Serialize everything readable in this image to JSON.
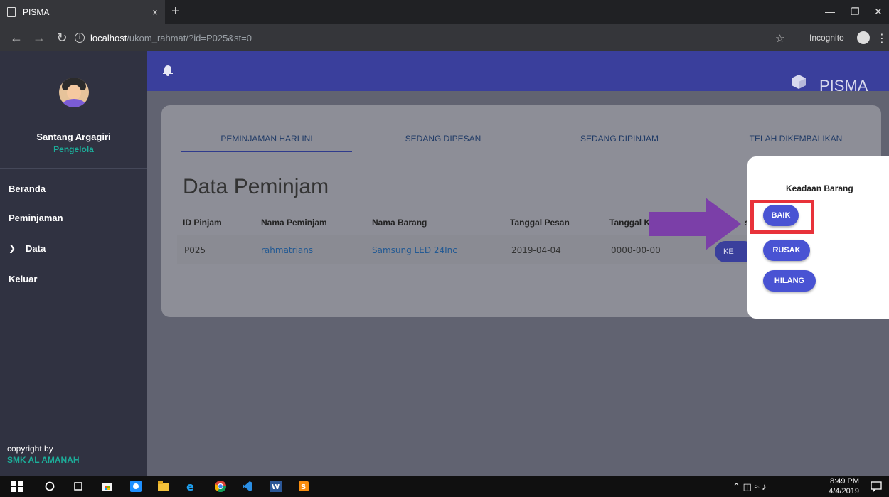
{
  "browser": {
    "tab_title": "PISMA",
    "tab_close": "×",
    "new_tab": "+",
    "url_host": "localhost",
    "url_path": "/ukom_rahmat/?id=P025&st=0",
    "incognito_label": "Incognito",
    "icons": [
      "back-icon",
      "forward-icon",
      "reload-icon",
      "info-icon",
      "star-icon",
      "incognito-icon",
      "kebab-menu-icon"
    ]
  },
  "sidebar": {
    "user_name": "Santang Argagiri",
    "user_role": "Pengelola",
    "items": [
      {
        "label": "Beranda"
      },
      {
        "label": "Peminjaman"
      },
      {
        "label": "Data"
      },
      {
        "label": "Keluar"
      }
    ],
    "copyright": "copyright by",
    "copyright_org": "SMK AL AMANAH"
  },
  "header": {
    "brand": "PISMA"
  },
  "main": {
    "tabs": [
      {
        "label": "PEMINJAMAN HARI INI",
        "active": true
      },
      {
        "label": "SEDANG DIPESAN",
        "active": false
      },
      {
        "label": "SEDANG DIPINJAM",
        "active": false
      },
      {
        "label": "TELAH DIKEMBALIKAN",
        "active": false
      }
    ],
    "heading": "Data Peminjam",
    "columns": [
      "ID Pinjam",
      "Nama Peminjam",
      "Nama Barang",
      "Tanggal Pesan",
      "Tanggal K",
      "si"
    ],
    "rows": [
      {
        "id": "P025",
        "nama_peminjam": "rahmatrians",
        "nama_barang": "Samsung LED 24Inc",
        "tanggal_pesan": "2019-04-04",
        "tanggal_k": "0000-00-00",
        "action": "KE"
      }
    ]
  },
  "popup": {
    "title": "Keadaan Barang",
    "buttons": [
      {
        "label": "BAIK"
      },
      {
        "label": "RUSAK"
      },
      {
        "label": "HILANG"
      }
    ]
  },
  "taskbar": {
    "time": "8:49 PM",
    "date": "4/4/2019"
  },
  "colors": {
    "header": "#3a3f9c",
    "sidebar": "#303241",
    "accent": "#1cae9a",
    "button": "#4953d3",
    "highlight": "#e8323a",
    "arrow": "#7b3fa8"
  }
}
